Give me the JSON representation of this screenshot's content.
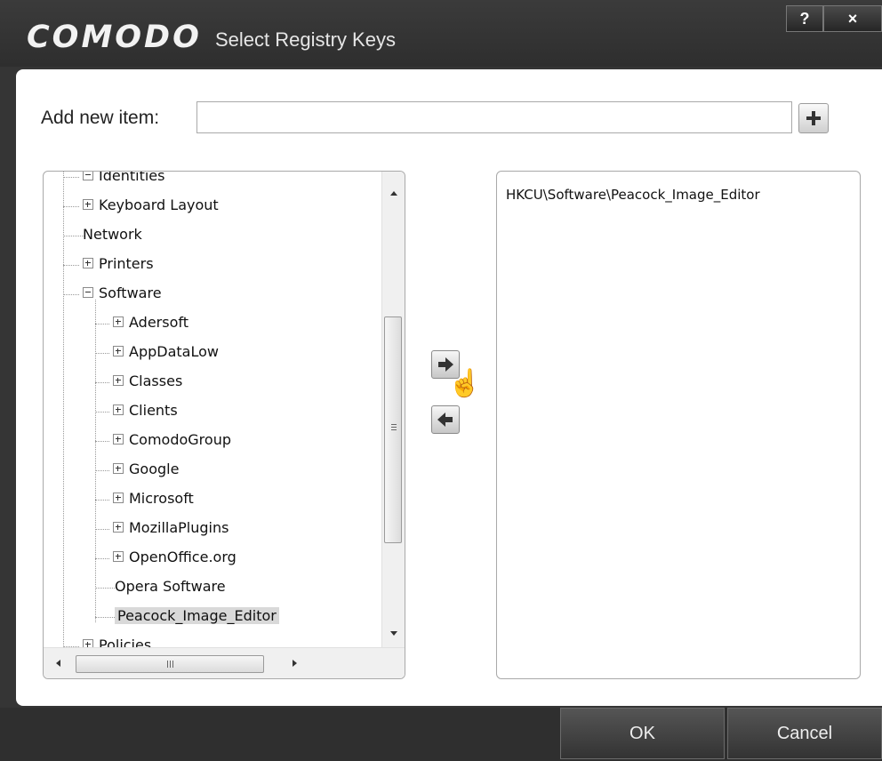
{
  "window": {
    "brand": "COMODO",
    "title": "Select Registry Keys",
    "help_label": "?",
    "close_label": "×"
  },
  "add_item": {
    "label": "Add new item:",
    "value": ""
  },
  "tree": {
    "items": [
      {
        "label": "Identities",
        "expander": "minus",
        "partial": true
      },
      {
        "label": "Keyboard Layout",
        "expander": "plus"
      },
      {
        "label": "Network",
        "expander": "none"
      },
      {
        "label": "Printers",
        "expander": "plus"
      },
      {
        "label": "Software",
        "expander": "minus"
      },
      {
        "label": "Adersoft",
        "expander": "plus"
      },
      {
        "label": "AppDataLow",
        "expander": "plus"
      },
      {
        "label": "Classes",
        "expander": "plus"
      },
      {
        "label": "Clients",
        "expander": "plus"
      },
      {
        "label": "ComodoGroup",
        "expander": "plus"
      },
      {
        "label": "Google",
        "expander": "plus"
      },
      {
        "label": "Microsoft",
        "expander": "plus"
      },
      {
        "label": "MozillaPlugins",
        "expander": "plus"
      },
      {
        "label": "OpenOffice.org",
        "expander": "plus"
      },
      {
        "label": "Opera Software",
        "expander": "none"
      },
      {
        "label": "Peacock_Image_Editor",
        "expander": "none",
        "selected": true
      },
      {
        "label": "Policies",
        "expander": "plus",
        "partial": true
      }
    ]
  },
  "selected_list": {
    "items": [
      "HKCU\\Software\\Peacock_Image_Editor"
    ]
  },
  "footer": {
    "ok_label": "OK",
    "cancel_label": "Cancel"
  }
}
